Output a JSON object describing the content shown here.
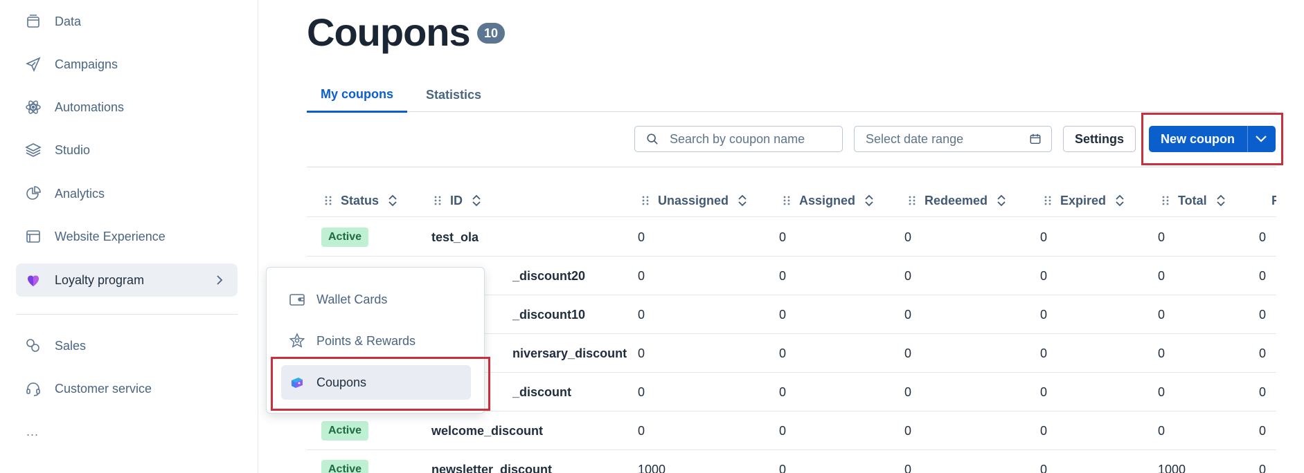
{
  "sidebar": {
    "items": [
      {
        "label": "Data",
        "icon": "database-icon"
      },
      {
        "label": "Campaigns",
        "icon": "paper-plane-icon"
      },
      {
        "label": "Automations",
        "icon": "atom-icon"
      },
      {
        "label": "Studio",
        "icon": "layers-icon"
      },
      {
        "label": "Analytics",
        "icon": "pie-chart-icon"
      },
      {
        "label": "Website Experience",
        "icon": "browser-window-icon"
      },
      {
        "label": "Loyalty program",
        "icon": "heart-icon"
      },
      {
        "label": "Sales",
        "icon": "coins-icon"
      },
      {
        "label": "Customer service",
        "icon": "headset-icon"
      }
    ],
    "more": "..."
  },
  "loyalty_flyout": {
    "items": [
      {
        "label": "Wallet Cards",
        "icon": "wallet-icon"
      },
      {
        "label": "Points & Rewards",
        "icon": "star-badge-icon"
      },
      {
        "label": "Coupons",
        "icon": "coupon-icon"
      }
    ]
  },
  "page": {
    "title": "Coupons",
    "count": "10"
  },
  "tabs": [
    {
      "label": "My coupons",
      "active": true
    },
    {
      "label": "Statistics",
      "active": false
    }
  ],
  "toolbar": {
    "search_placeholder": "Search by coupon name",
    "date_placeholder": "Select date range",
    "settings_label": "Settings",
    "new_coupon_label": "New coupon"
  },
  "table": {
    "columns": [
      "Status",
      "ID",
      "Unassigned",
      "Assigned",
      "Redeemed",
      "Expired",
      "Total",
      "R"
    ],
    "rows": [
      {
        "status": "Active",
        "id": "test_ola",
        "unassigned": "0",
        "assigned": "0",
        "redeemed": "0",
        "expired": "0",
        "total": "0",
        "r": "0"
      },
      {
        "status": "",
        "id": "_discount20",
        "unassigned": "0",
        "assigned": "0",
        "redeemed": "0",
        "expired": "0",
        "total": "0",
        "r": "0"
      },
      {
        "status": "",
        "id": "_discount10",
        "unassigned": "0",
        "assigned": "0",
        "redeemed": "0",
        "expired": "0",
        "total": "0",
        "r": "0"
      },
      {
        "status": "",
        "id": "niversary_discount",
        "unassigned": "0",
        "assigned": "0",
        "redeemed": "0",
        "expired": "0",
        "total": "0",
        "r": "0"
      },
      {
        "status": "",
        "id": "_discount",
        "unassigned": "0",
        "assigned": "0",
        "redeemed": "0",
        "expired": "0",
        "total": "0",
        "r": "0"
      },
      {
        "status": "Active",
        "id": "welcome_discount",
        "unassigned": "0",
        "assigned": "0",
        "redeemed": "0",
        "expired": "0",
        "total": "0",
        "r": "0"
      },
      {
        "status": "Active",
        "id": "newsletter_discount",
        "unassigned": "1000",
        "assigned": "0",
        "redeemed": "0",
        "expired": "0",
        "total": "1000",
        "r": "0"
      }
    ]
  },
  "colors": {
    "accent": "#0b5fcc",
    "highlight": "#c8313b",
    "active_pill_bg": "#bff0d3",
    "active_pill_text": "#1d6b3f"
  }
}
